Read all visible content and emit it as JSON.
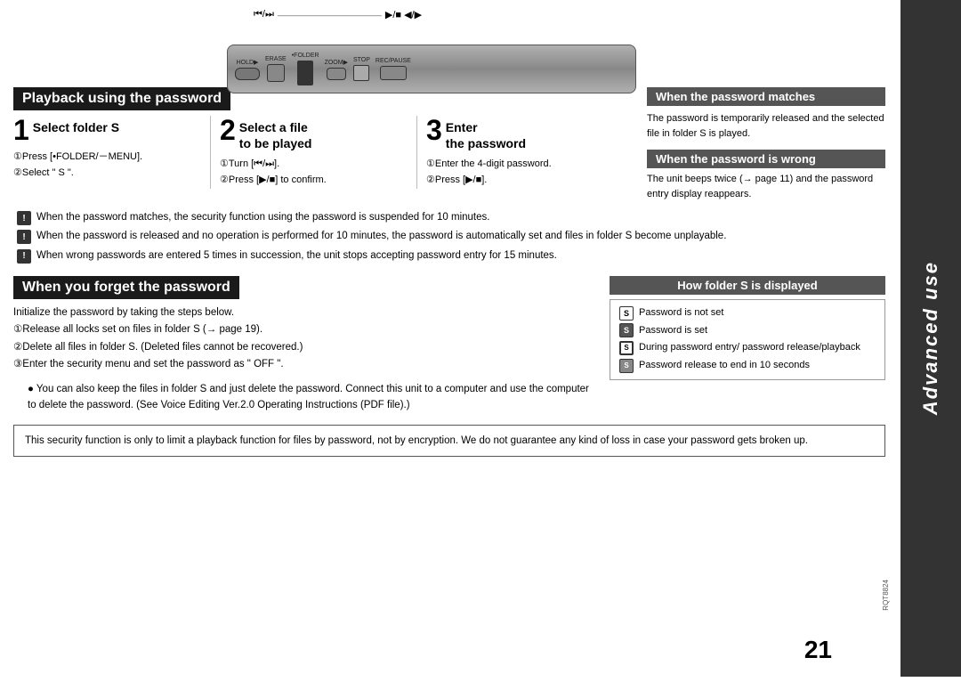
{
  "page": {
    "page_number": "21",
    "rqt_code": "RQT8824"
  },
  "sidebar": {
    "title": "Advanced use"
  },
  "section1": {
    "header": "Playback using the password",
    "step1": {
      "number": "1",
      "title": "Select folder S",
      "sub1": "①Press [•FOLDER/－MENU].",
      "sub2": "②Select \" S \"."
    },
    "step2": {
      "number": "2",
      "title1": "Select a file",
      "title2": "to be played",
      "sub1": "①Turn [⏮/⏭].",
      "sub2": "②Press [▶/■] to confirm."
    },
    "step3": {
      "number": "3",
      "title1": "Enter",
      "title2": "the password",
      "sub1": "①Enter the 4-digit password.",
      "sub2": "②Press [▶/■]."
    },
    "matches_header": "When the password matches",
    "matches_text": "The password is temporarily released and the selected file in folder S is played.",
    "wrong_header": "When the password is wrong",
    "wrong_text": "The unit beeps twice (→ page 11) and the password entry display reappears.",
    "notes": [
      "When the password matches, the security function using the password is suspended for 10 minutes.",
      "When the password is released and no operation is performed for 10 minutes, the password is automatically set and files in folder S become unplayable.",
      "When wrong passwords are entered 5 times in succession, the unit stops accepting password entry for 15 minutes."
    ]
  },
  "section2": {
    "header": "When you forget the password",
    "intro": "Initialize the password by taking the steps below.",
    "steps": [
      "①Release all locks set on files in folder S (→ page 19).",
      "②Delete all files in folder S. (Deleted files cannot be recovered.)",
      "③Enter the security menu and set the password as \" OFF \"."
    ],
    "computer_note": "● You can also keep the files in folder S and just delete the password. Connect this unit to a computer and use the computer to delete the password. (See Voice Editing Ver.2.0 Operating Instructions (PDF file).)",
    "folder_display": {
      "header": "How folder S is displayed",
      "items": [
        {
          "icon": "empty",
          "text": "Password is not set"
        },
        {
          "icon": "filled",
          "text": "Password is set"
        },
        {
          "icon": "lock-outline",
          "text": "During password entry/ password release/playback"
        },
        {
          "icon": "lock-filled",
          "text": "Password release to end in 10 seconds"
        }
      ]
    }
  },
  "disclaimer": "This security function is only to limit a playback function for files by password, not by encryption. We do not guarantee any kind of loss in case your password gets broken up."
}
